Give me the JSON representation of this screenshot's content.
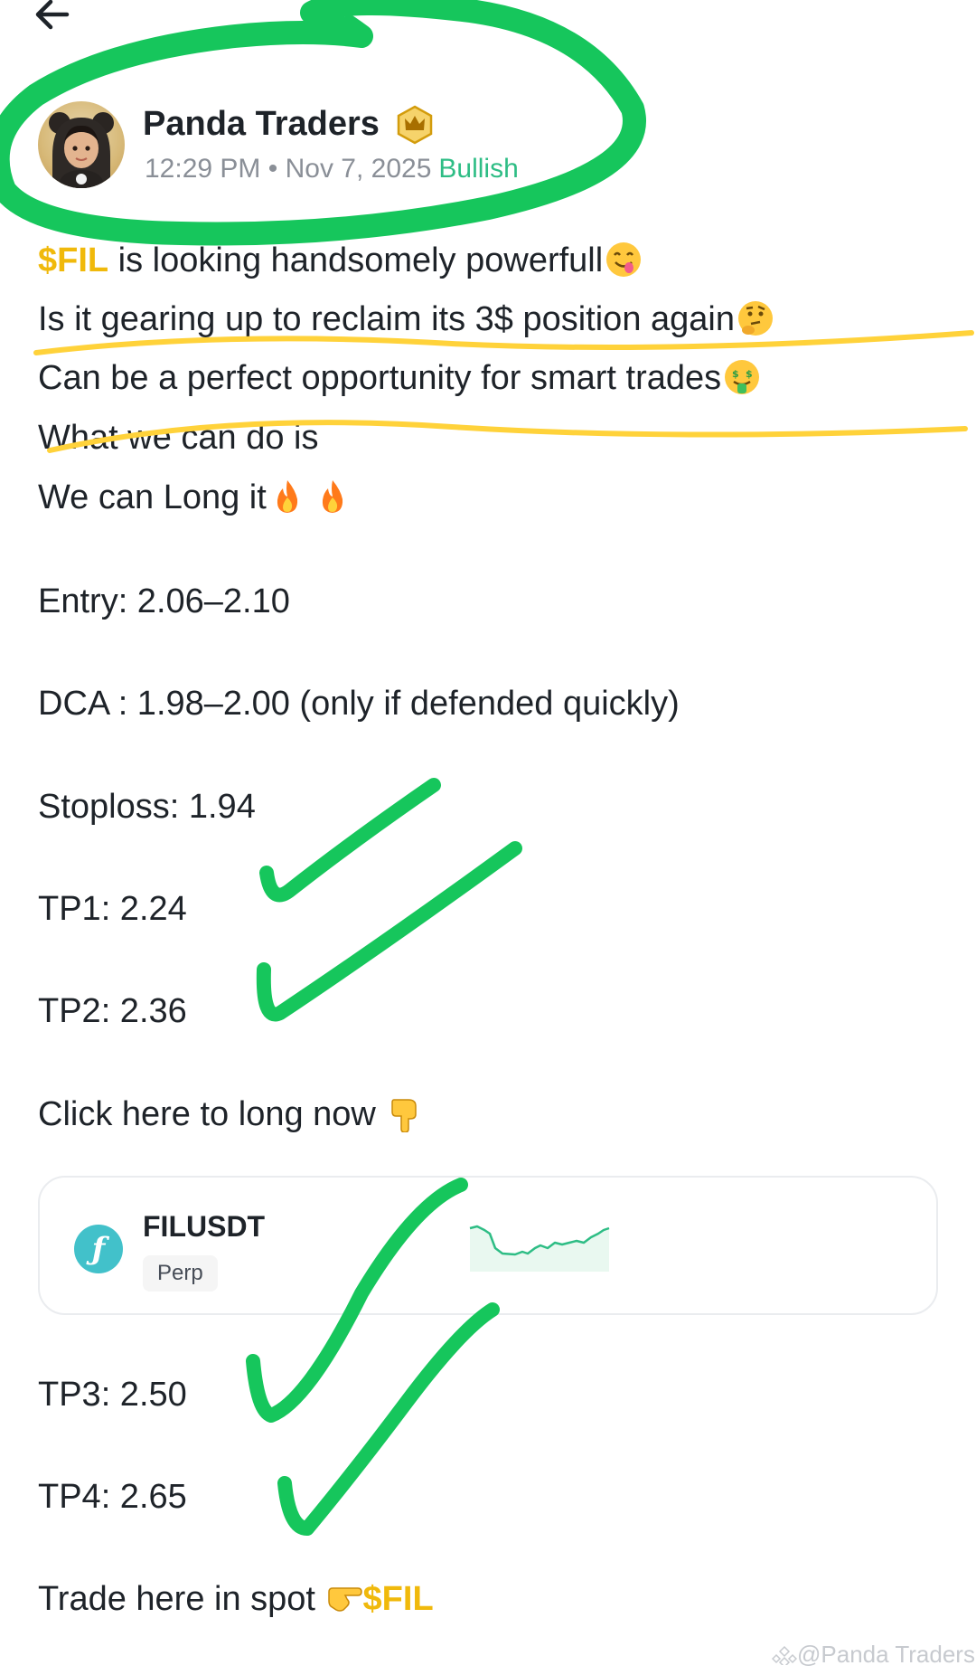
{
  "header": {
    "back_icon": "arrow-left-icon"
  },
  "author": {
    "name": "Panda Traders",
    "badge_icon": "crown-icon",
    "time": "12:29 PM",
    "separator": "•",
    "date": "Nov 7, 2025",
    "sentiment": "Bullish"
  },
  "post": {
    "line1_tag": "$FIL",
    "line1_text": " is looking handsomely powerfull",
    "line1_emoji": "yum-face-icon",
    "line2_text": "Is it gearing up to reclaim its 3$ position again",
    "line2_emoji": "thinking-face-icon",
    "line3_text": "Can be a perfect opportunity for smart trades",
    "line3_emoji": "money-mouth-face-icon",
    "line4_text": "What we can do is",
    "line5_text": "We can Long it",
    "line5_emoji": "fire-icon",
    "entry": "Entry: 2.06–2.10",
    "dca": "DCA : 1.98–2.00 (only if defended quickly)",
    "stoploss": "Stoploss: 1.94",
    "tp1": "TP1: 2.24",
    "tp2": "TP2: 2.36",
    "cta": "Click here to long now ",
    "cta_emoji": "pointing-down-icon",
    "tp3": "TP3: 2.50",
    "tp4": "TP4: 2.65",
    "spot_text": "Trade here in spot ",
    "spot_emoji": "pointing-right-icon",
    "spot_tag": "$FIL"
  },
  "card": {
    "coin_icon": "filecoin-icon",
    "symbol": "FILUSDT",
    "type": "Perp"
  },
  "watermark": "@Panda Traders",
  "colors": {
    "tag": "#f0b90b",
    "sentiment": "#2ebd85",
    "marker_green": "#16c65c",
    "marker_yellow": "#ffd23a"
  }
}
